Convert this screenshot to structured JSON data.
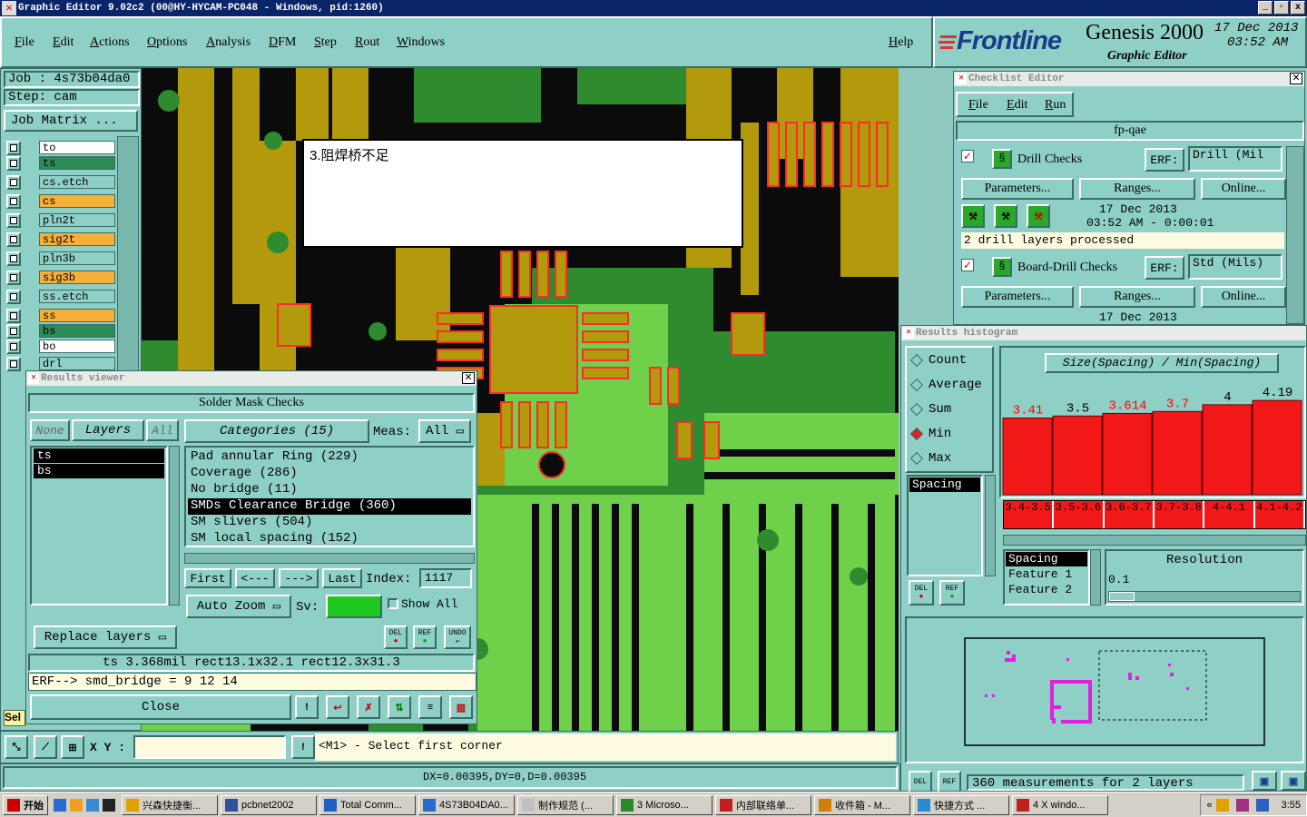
{
  "window": {
    "title": "Graphic Editor 9.02c2  (00@HY-HYCAM-PC048 - Windows, pid:1260)",
    "min": "_",
    "max": "▫",
    "close": "x"
  },
  "menu": {
    "items": [
      "File",
      "Edit",
      "Actions",
      "Options",
      "Analysis",
      "DFM",
      "Step",
      "Rout",
      "Windows"
    ],
    "help": "Help"
  },
  "brand": {
    "logo": "Frontline",
    "product": "Genesis 2000",
    "subtitle": "Graphic Editor",
    "date": "17 Dec 2013",
    "time": "03:52 AM"
  },
  "job": {
    "job_label": "Job : 4s73b04da0",
    "step_label": "Step: cam",
    "matrix_button": "Job Matrix ..."
  },
  "layers": [
    {
      "name": "to",
      "color": "#ffffff"
    },
    {
      "name": "ts",
      "color": "#2e8b57"
    },
    {
      "name": "cs.etch",
      "color": "#8fd0c6"
    },
    {
      "name": "cs",
      "color": "#f5b03a"
    },
    {
      "name": "pln2t",
      "color": "#8fd0c6"
    },
    {
      "name": "sig2t",
      "color": "#f5b03a"
    },
    {
      "name": "pln3b",
      "color": "#8fd0c6"
    },
    {
      "name": "sig3b",
      "color": "#f5b03a"
    },
    {
      "name": "ss.etch",
      "color": "#8fd0c6"
    },
    {
      "name": "ss",
      "color": "#f5b03a"
    },
    {
      "name": "bs",
      "color": "#2e8b57"
    },
    {
      "name": "bo",
      "color": "#ffffff"
    },
    {
      "name": "drl",
      "color": "#8fd0c6"
    }
  ],
  "annotation": {
    "text": "3.阻焊桥不足"
  },
  "results_viewer": {
    "title": "Results viewer",
    "header": "Solder Mask Checks",
    "none": "None",
    "layers": "Layers",
    "all": "All",
    "layer_list": [
      "ts",
      "bs"
    ],
    "categories_label": "Categories (15)",
    "meas_label": "Meas:",
    "meas_value": "All",
    "categories": [
      "Pad annular Ring (229)",
      "Coverage (286)",
      "No bridge (11)",
      "SMDs Clearance Bridge (360)",
      "SM slivers (504)",
      "SM local spacing (152)"
    ],
    "selected_category": 3,
    "nav": {
      "first": "First",
      "prev": "<---",
      "next": "--->",
      "last": "Last",
      "index_label": "Index:",
      "index_value": "1117"
    },
    "auto_zoom": "Auto Zoom",
    "sv_label": "Sv:",
    "show_all": "Show All",
    "replace_layers": "Replace layers",
    "del": "DEL",
    "ref": "REF",
    "undo": "UNDO",
    "status_line": "ts 3.368mil  rect13.1x32.1  rect12.3x31.3",
    "erf_line": "ERF--> smd_bridge = 9  12  14",
    "close": "Close"
  },
  "checklist": {
    "title": "Checklist Editor",
    "menu": [
      "File",
      "Edit",
      "Run"
    ],
    "name": "fp-qae",
    "checks": [
      {
        "name": "Drill Checks",
        "erf": "ERF:",
        "erf_value": "Drill (Mil",
        "params": "Parameters...",
        "ranges": "Ranges...",
        "online": "Online...",
        "date": "17 Dec 2013",
        "time": "03:52 AM - 0:00:01",
        "status": "2 drill layers processed"
      },
      {
        "name": "Board-Drill Checks",
        "erf": "ERF:",
        "erf_value": "Std (Mils)",
        "params": "Parameters...",
        "ranges": "Ranges...",
        "online": "Online...",
        "date": "17 Dec 2013"
      }
    ]
  },
  "histogram": {
    "title": "Results histogram",
    "modes": [
      "Count",
      "Average",
      "Sum",
      "Min",
      "Max"
    ],
    "selected_mode": "Min",
    "expression": "Size(Spacing) / Min(Spacing)",
    "left_list": [
      "Spacing"
    ],
    "del": "DEL",
    "ref": "REF",
    "feature_list": [
      "Spacing",
      "Feature 1",
      "Feature 2"
    ],
    "resolution_label": "Resolution",
    "resolution_value": "0.1",
    "summary": "360 measurements for 2 layers"
  },
  "chart_data": {
    "type": "bar",
    "categories": [
      "3.4-3.5",
      "3.5-3.6",
      "3.6-3.7",
      "3.7-3.8",
      "4-4.1",
      "4.1-4.2"
    ],
    "values": [
      3.41,
      3.5,
      3.614,
      3.7,
      4,
      4.19
    ],
    "labels": [
      "3.41",
      "3.5",
      "3.614",
      "3.7",
      "4",
      "4.19"
    ],
    "label_colors": [
      "#ff0000",
      "#000000",
      "#ff0000",
      "#ff0000",
      "#000000",
      "#000000"
    ],
    "ylim": [
      0,
      4.6
    ],
    "bar_color": "#f21818"
  },
  "bottom": {
    "xy_label": "X Y :",
    "prompt": "<M1> - Select first corner",
    "coords": "DX=0.00395,DY=0,D=0.00395",
    "sel": "Sel"
  },
  "taskbar": {
    "start": "开始",
    "tasks": [
      "兴森快捷衡...",
      "pcbnet2002",
      "Total Comm...",
      "4S73B04DA0...",
      "制作规范 (...",
      "3 Microso...",
      "内部联络单...",
      "收件箱 - M...",
      "快捷方式 ...",
      "4 X windo..."
    ],
    "clock": "3:55"
  }
}
